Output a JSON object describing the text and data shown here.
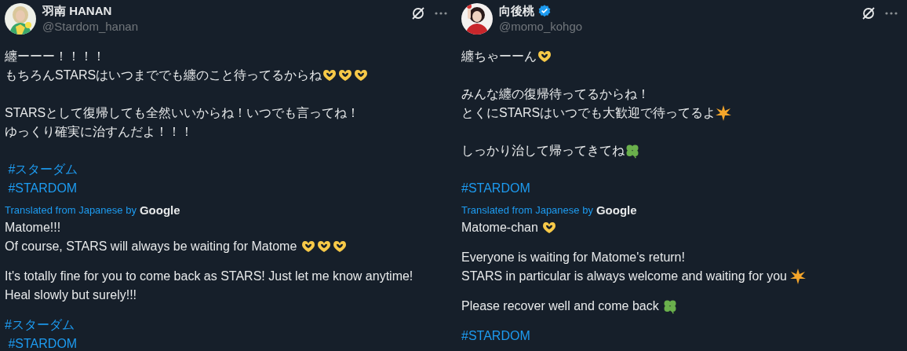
{
  "tweets": [
    {
      "name": "羽南 HANAN",
      "verified": false,
      "handle": "@Stardom_hanan",
      "original": {
        "paragraphs": [
          {
            "lines": [
              {
                "text": "纏ーーー！！！！"
              },
              {
                "text": "もちろんSTARSはいつまででも纏のこと待ってるからね",
                "emoji": [
                  {
                    "kind": "heart-hands"
                  },
                  {
                    "kind": "heart-hands"
                  },
                  {
                    "kind": "heart-hands"
                  }
                ]
              }
            ]
          },
          {
            "lines": [
              {
                "text": "STARSとして復帰しても全然いいからね！いつでも言ってね！"
              },
              {
                "text": "ゆっくり確実に治すんだよ！！！"
              }
            ]
          },
          {
            "hashtags": [
              " #スターダム",
              " #STARDOM"
            ]
          }
        ]
      },
      "translation_label": "Translated from Japanese by",
      "translation_brand": "Google",
      "translated": {
        "paragraphs": [
          {
            "lines": [
              {
                "text": "Matome!!!"
              },
              {
                "text": "Of course, STARS will always be waiting for Matome ",
                "emoji": [
                  {
                    "kind": "heart-hands"
                  },
                  {
                    "kind": "heart-hands"
                  },
                  {
                    "kind": "heart-hands"
                  }
                ]
              }
            ]
          },
          {
            "lines": [
              {
                "text": "It's totally fine for you to come back as STARS! Just let me know anytime!"
              },
              {
                "text": "Heal slowly but surely!!!"
              }
            ]
          },
          {
            "hashtags": [
              "#スターダム",
              " #STARDOM"
            ]
          }
        ]
      }
    },
    {
      "name": "向後桃",
      "verified": true,
      "handle": "@momo_kohgo",
      "original": {
        "paragraphs": [
          {
            "lines": [
              {
                "text": "纏ちゃーーん",
                "emoji": [
                  {
                    "kind": "heart-hands"
                  }
                ]
              }
            ]
          },
          {
            "lines": [
              {
                "text": "みんな纏の復帰待ってるからね！"
              },
              {
                "text": "とくにSTARSはいつでも大歓迎で待ってるよ",
                "emoji": [
                  {
                    "kind": "sparkle"
                  }
                ]
              }
            ]
          },
          {
            "lines": [
              {
                "text": "しっかり治して帰ってきてね",
                "emoji": [
                  {
                    "kind": "clover"
                  }
                ]
              }
            ]
          },
          {
            "hashtags": [
              "#STARDOM"
            ]
          }
        ]
      },
      "translation_label": "Translated from Japanese by",
      "translation_brand": "Google",
      "translated": {
        "paragraphs": [
          {
            "lines": [
              {
                "text": "Matome-chan ",
                "emoji": [
                  {
                    "kind": "heart-hands"
                  }
                ]
              }
            ]
          },
          {
            "lines": [
              {
                "text": "Everyone is waiting for Matome's return!"
              },
              {
                "text": "STARS in particular is always welcome and waiting for you ",
                "emoji": [
                  {
                    "kind": "sparkle"
                  }
                ]
              }
            ]
          },
          {
            "lines": [
              {
                "text": "Please recover well and come back ",
                "emoji": [
                  {
                    "kind": "clover"
                  }
                ]
              }
            ]
          },
          {
            "hashtags": [
              "#STARDOM"
            ]
          }
        ]
      }
    }
  ]
}
